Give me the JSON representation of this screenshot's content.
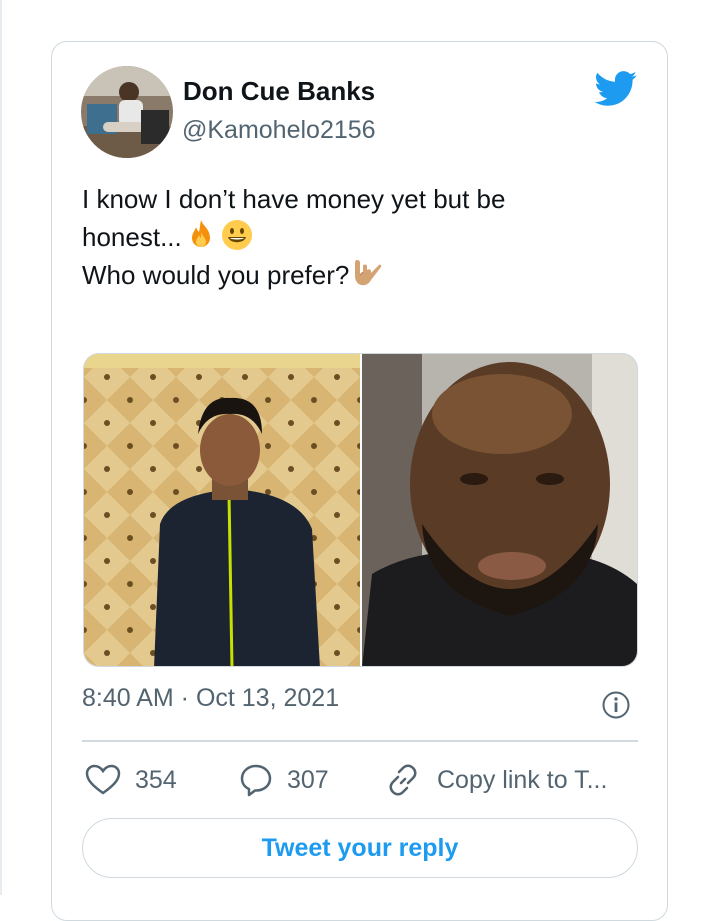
{
  "user": {
    "display_name": "Don Cue Banks",
    "handle": "@Kamohelo2156",
    "avatar_icon": "profile-photo"
  },
  "tweet": {
    "line1": "I know I don’t have money yet but be",
    "line2": "honest...",
    "line2_emojis": [
      "fire-emoji",
      "grinning-face-emoji"
    ],
    "line3": "Who would you prefer?",
    "line3_emoji": "love-you-gesture-emoji",
    "timestamp": "8:40 AM · Oct 13, 2021"
  },
  "media": {
    "count": 2,
    "items": [
      "photo-man-in-black-jacket",
      "photo-bald-bearded-man"
    ]
  },
  "actions": {
    "like_count": "354",
    "reply_count": "307",
    "copy_link_label": "Copy link to T..."
  },
  "reply_button_label": "Tweet your reply",
  "colors": {
    "brand_blue": "#1d9bf0",
    "text_primary": "#0f1419",
    "text_secondary": "#536471",
    "border": "#cfd9de"
  }
}
